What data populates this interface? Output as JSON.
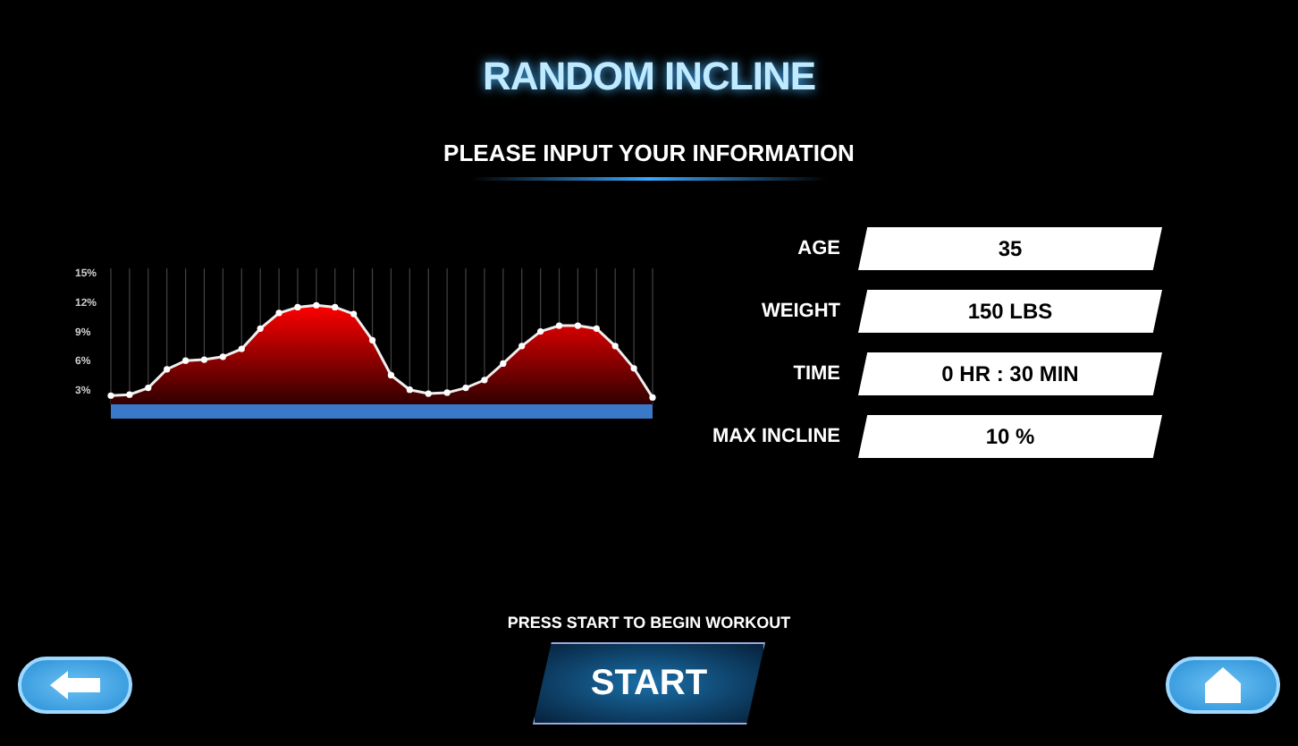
{
  "title": "RANDOM INCLINE",
  "subtitle": "PLEASE INPUT YOUR INFORMATION",
  "profile": {
    "chart_data": {
      "type": "area",
      "categories": [
        null,
        null,
        null,
        null,
        null,
        null,
        null,
        null,
        null,
        null,
        null,
        null,
        null,
        null,
        null,
        null,
        null,
        null,
        null,
        null,
        null,
        null,
        null,
        null,
        null,
        null,
        null,
        null,
        null,
        null
      ],
      "ylim": [
        1.5,
        15.5
      ],
      "grid": true,
      "yticks": [
        {
          "value": 3,
          "label": "3%"
        },
        {
          "value": 6,
          "label": "6%"
        },
        {
          "value": 9,
          "label": "9%"
        },
        {
          "value": 12,
          "label": "12%"
        },
        {
          "value": 15,
          "label": "15%"
        }
      ],
      "series": [
        {
          "color": "#eeeeee",
          "values": [
            2.4,
            2.5,
            3.2,
            5.1,
            6.0,
            6.1,
            6.4,
            7.2,
            9.3,
            10.9,
            11.5,
            11.7,
            11.5,
            10.8,
            8.1,
            4.5,
            3.0,
            2.6,
            2.7,
            3.2,
            4.0,
            5.7,
            7.5,
            9.0,
            9.6,
            9.6,
            9.3,
            7.5,
            5.2,
            2.2
          ]
        }
      ]
    }
  },
  "fields": [
    {
      "label": "AGE",
      "value": "35"
    },
    {
      "label": "WEIGHT",
      "value": "150  LBS"
    },
    {
      "label": "TIME",
      "value": "0 HR : 30  MIN"
    },
    {
      "label": "MAX INCLINE",
      "value": "10  %"
    }
  ],
  "hint": "PRESS START TO BEGIN WORKOUT",
  "start": "START"
}
